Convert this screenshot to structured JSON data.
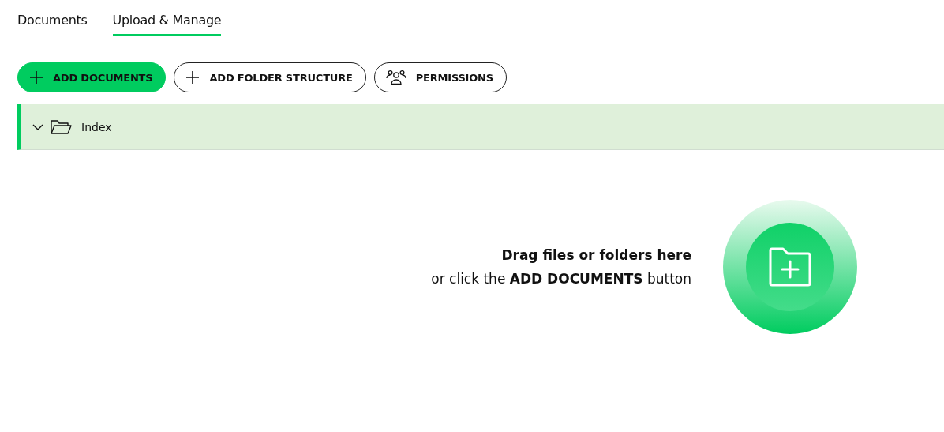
{
  "tabs": [
    {
      "label": "Documents",
      "selected": false
    },
    {
      "label": "Upload & Manage",
      "selected": true
    }
  ],
  "toolbar": [
    {
      "label": "ADD DOCUMENTS",
      "kind": "primary"
    },
    {
      "label": "ADD FOLDER STRUCTURE",
      "kind": "add"
    },
    {
      "label": "PERMISSIONS",
      "kind": "permissions"
    }
  ],
  "tree": [
    {
      "label": "Index",
      "expanded": true,
      "selected": true
    }
  ],
  "drop_zone": {
    "title": "Drag files or folders here",
    "hint": "or click the **ADD DOCUMENTS** button"
  }
}
